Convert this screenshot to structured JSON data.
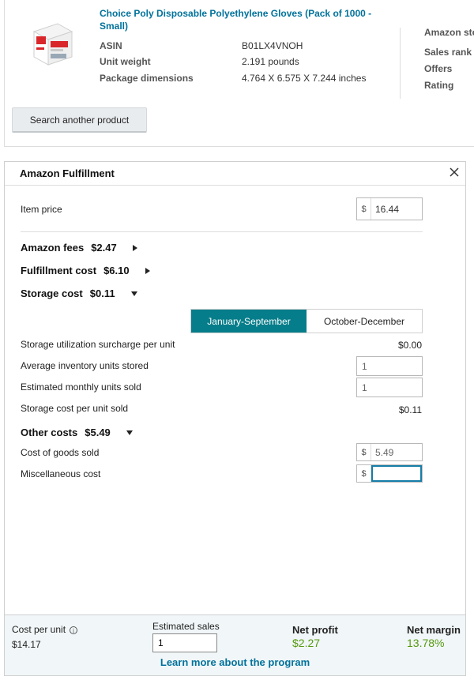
{
  "product": {
    "title": "Choice Poly Disposable Polyethylene Gloves (Pack of 1000 - Small)",
    "thumbnail_icon": "product-box-image",
    "details": [
      {
        "label": "ASIN",
        "value": "B01LX4VNOH"
      },
      {
        "label": "Unit weight",
        "value": "2.191 pounds"
      },
      {
        "label": "Package dimensions",
        "value": "4.764 X 6.575 X 7.244 inches"
      }
    ],
    "side_stats": [
      "Amazon sto",
      "Sales rank",
      "Offers",
      "Rating"
    ],
    "search_button_label": "Search another product"
  },
  "panel": {
    "title": "Amazon Fulfillment",
    "close_icon": "close-icon",
    "item_price": {
      "label": "Item price",
      "currency": "$",
      "value": "16.44"
    },
    "amazon_fees": {
      "label": "Amazon fees",
      "amount": "$2.47",
      "expanded": false
    },
    "fulfillment_cost": {
      "label": "Fulfillment cost",
      "amount": "$6.10",
      "expanded": false
    },
    "storage_cost": {
      "label": "Storage cost",
      "amount": "$0.11",
      "expanded": true,
      "season_tabs": [
        {
          "label": "January-September",
          "active": true
        },
        {
          "label": "October-December",
          "active": false
        }
      ],
      "surcharge": {
        "label": "Storage utilization surcharge per unit",
        "value": "$0.00"
      },
      "avg_inventory": {
        "label": "Average inventory units stored",
        "value": "1"
      },
      "monthly_sold": {
        "label": "Estimated monthly units sold",
        "value": "1"
      },
      "cost_per_unit_sold": {
        "label": "Storage cost per unit sold",
        "value": "$0.11"
      }
    },
    "other_costs": {
      "label": "Other costs",
      "amount": "$5.49",
      "expanded": true,
      "cogs": {
        "label": "Cost of goods sold",
        "currency": "$",
        "value": "5.49"
      },
      "misc": {
        "label": "Miscellaneous cost",
        "currency": "$",
        "value": ""
      }
    }
  },
  "footer": {
    "cost_per_unit": {
      "label": "Cost per unit",
      "value": "$14.17"
    },
    "estimated_sales": {
      "label": "Estimated sales",
      "value": "1"
    },
    "net_profit": {
      "label": "Net profit",
      "value": "$2.27"
    },
    "net_margin": {
      "label": "Net margin",
      "value": "13.78%"
    },
    "learn_more": "Learn more about the program",
    "accent_color": "#569a12",
    "link_color": "#00729b"
  }
}
